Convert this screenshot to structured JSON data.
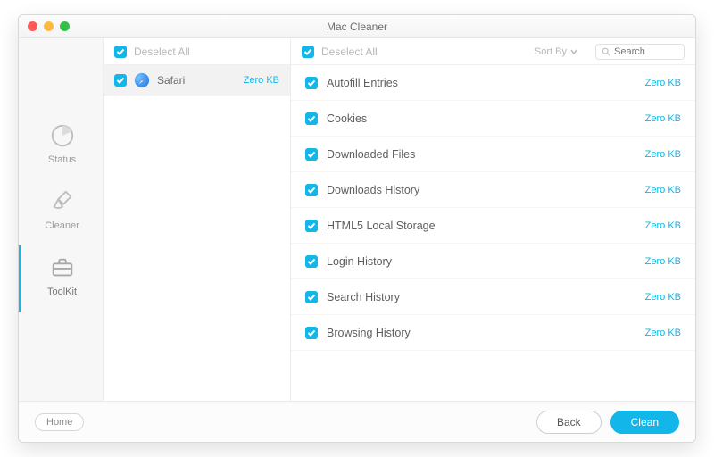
{
  "window": {
    "title": "Mac Cleaner"
  },
  "sidebar": {
    "items": [
      {
        "key": "status",
        "label": "Status"
      },
      {
        "key": "cleaner",
        "label": "Cleaner"
      },
      {
        "key": "toolkit",
        "label": "ToolKit"
      }
    ],
    "selected": "toolkit"
  },
  "middle": {
    "deselect_label": "Deselect All",
    "items": [
      {
        "app": "Safari",
        "size": "Zero KB",
        "checked": true
      }
    ]
  },
  "right": {
    "deselect_label": "Deselect All",
    "sort_label": "Sort By",
    "search_placeholder": "Search",
    "items": [
      {
        "label": "Autofill Entries",
        "size": "Zero KB"
      },
      {
        "label": "Cookies",
        "size": "Zero KB"
      },
      {
        "label": "Downloaded Files",
        "size": "Zero KB"
      },
      {
        "label": "Downloads History",
        "size": "Zero KB"
      },
      {
        "label": "HTML5 Local Storage",
        "size": "Zero KB"
      },
      {
        "label": "Login History",
        "size": "Zero KB"
      },
      {
        "label": "Search History",
        "size": "Zero KB"
      },
      {
        "label": "Browsing History",
        "size": "Zero KB"
      }
    ]
  },
  "footer": {
    "home": "Home",
    "back": "Back",
    "clean": "Clean"
  },
  "colors": {
    "accent": "#12b6e8"
  }
}
